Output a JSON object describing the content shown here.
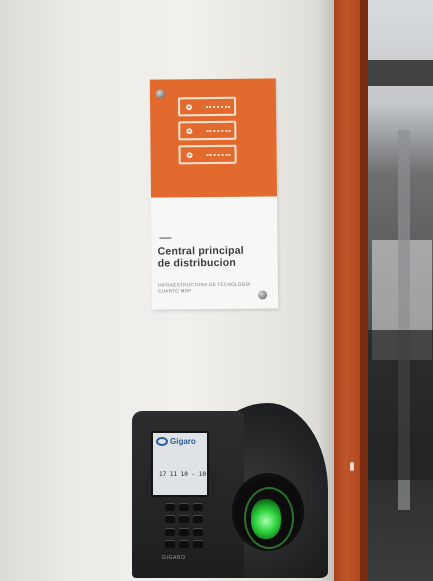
{
  "sign": {
    "title_line1": "Central principal",
    "title_line2": "de distribucion",
    "subtitle": "INFRAESTRUCTURA DE TECNOLOGÍA · CUARTO MDF"
  },
  "device": {
    "logo_text": "Gigaro",
    "clock_text": "17 11 10 - 10:40",
    "brand_text": "GIGARO"
  },
  "colors": {
    "sign_accent": "#e36a2e",
    "door_frame": "#b54b22",
    "sensor_light": "#2fd43f"
  },
  "icons": [
    "server-rack-icon",
    "fingerprint-sensor-icon"
  ]
}
